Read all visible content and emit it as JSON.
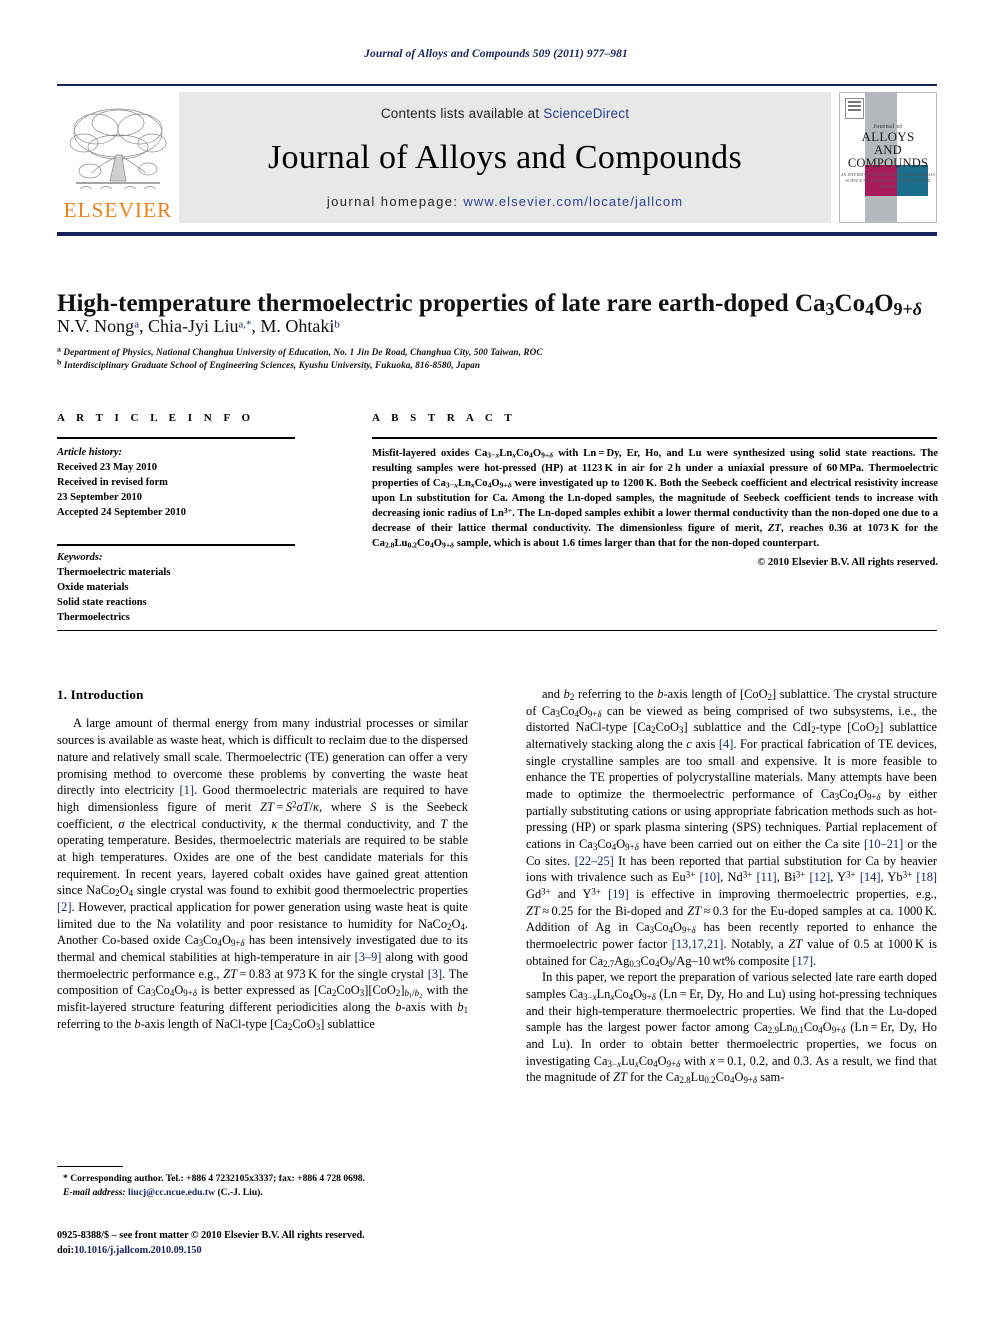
{
  "running_head": "Journal of Alloys and Compounds 509 (2011) 977–981",
  "masthead": {
    "contents_prefix": "Contents lists available at ",
    "sciencedirect": "ScienceDirect",
    "journal_title": "Journal of Alloys and Compounds",
    "homepage_prefix": "journal homepage: ",
    "homepage_url": "www.elsevier.com/locate/jallcom",
    "publisher": "ELSEVIER",
    "cover": {
      "line1": "Journal of",
      "line2": "ALLOYS",
      "line3": "AND COMPOUNDS",
      "line4": "AN INTERDISCIPLINARY JOURNAL OF MATERIALS SCIENCE AND SOLID-STATE CHEMISTRY AND PHYSICS"
    },
    "colors": {
      "rule": "#17215e",
      "panel": "#e8e8e9",
      "link": "#2b3e8c",
      "elsevier_orange": "#ef7f1a",
      "cover_magenta": "#a81b59",
      "cover_teal": "#1b6e8c",
      "cover_gray": "#b5b9bd"
    }
  },
  "article": {
    "title_html": "High-temperature thermoelectric properties of late rare earth-doped Ca<sub>3</sub>Co<sub>4</sub>O<sub>9+<i>&delta;</i></sub>",
    "authors_html": "N.V. Nong<sup>a</sup>, Chia-Jyi Liu<sup>a,*</sup>, M. Ohtaki<sup>b</sup>",
    "affiliation_a_html": "<sup>a</sup> Department of Physics, National Changhua University of Education, No. 1 Jin De Road, Changhua City, 500 Taiwan, ROC",
    "affiliation_b_html": "<sup>b</sup> Interdisciplinary Graduate School of Engineering Sciences, Kyushu University, Fukuoka, 816-8580, Japan"
  },
  "article_info": {
    "heading": "A R T I C L E   I N F O",
    "history_label": "Article history:",
    "history": [
      "Received 23 May 2010",
      "Received in revised form",
      "23 September 2010",
      "Accepted 24 September 2010"
    ],
    "keywords_label": "Keywords:",
    "keywords": [
      "Thermoelectric materials",
      "Oxide materials",
      "Solid state reactions",
      "Thermoelectrics"
    ]
  },
  "abstract": {
    "heading": "A B S T R A C T",
    "body_html": "Misfit-layered oxides Ca<sub>3&minus;<i>x</i></sub>Ln<sub><i>x</i></sub>Co<sub>4</sub>O<sub>9+<i>&delta;</i></sub> with Ln&#8239;=&#8239;Dy, Er, Ho, and Lu were synthesized using solid state reactions. The resulting samples were hot-pressed (HP) at 1123&#8201;K in air for 2&#8201;h under a uniaxial pressure of 60&#8201;MPa. Thermoelectric properties of Ca<sub>3&minus;<i>x</i></sub>Ln<sub><i>x</i></sub>Co<sub>4</sub>O<sub>9+<i>&delta;</i></sub> were investigated up to 1200&#8201;K. Both the Seebeck coefficient and electrical resistivity increase upon Ln substitution for Ca. Among the Ln-doped samples, the magnitude of Seebeck coefficient tends to increase with decreasing ionic radius of Ln<sup>3+</sup>. The Ln-doped samples exhibit a lower thermal conductivity than the non-doped one due to a decrease of their lattice thermal conductivity. The dimensionless figure of merit, <i>ZT</i>, reaches 0.36 at 1073&#8201;K for the Ca<sub>2.8</sub>Lu<sub>0.2</sub>Co<sub>4</sub>O<sub>9+<i>&delta;</i></sub> sample, which is about 1.6 times larger than that for the non-doped counterpart.",
    "copyright": "© 2010 Elsevier B.V. All rights reserved."
  },
  "body": {
    "section1_heading": "1.  Introduction",
    "left_paragraph_html": "A large amount of thermal energy from many industrial processes or similar sources is available as waste heat, which is difficult to reclaim due to the dispersed nature and relatively small scale. Thermoelectric (TE) generation can offer a very promising method to overcome these problems by converting the waste heat directly into electricity <span class=\"ref\">[1]</span>. Good thermoelectric materials are required to have high dimensionless figure of merit <i>ZT</i>&#8239;=&#8239;<i>S</i><sup>2</sup><i>&sigma;T</i>/<i>&kappa;</i>, where <i>S</i> is the Seebeck coefficient, <i>&sigma;</i> the electrical conductivity, <i>&kappa;</i> the thermal conductivity, and <i>T</i> the operating temperature. Besides, thermoelectric materials are required to be stable at high temperatures. Oxides are one of the best candidate materials for this requirement. In recent years, layered cobalt oxides have gained great attention since NaCo<sub>2</sub>O<sub>4</sub> single crystal was found to exhibit good thermoelectric properties <span class=\"ref\">[2]</span>. However, practical application for power generation using waste heat is quite limited due to the Na volatility and poor resistance to humidity for NaCo<sub>2</sub>O<sub>4</sub>. Another Co-based oxide Ca<sub>3</sub>Co<sub>4</sub>O<sub>9+<i>&delta;</i></sub> has been intensively investigated due to its thermal and chemical stabilities at high-temperature in air <span class=\"ref\">[3–9]</span> along with good thermoelectric performance e.g., <i>ZT</i>&#8239;=&#8239;0.83 at 973&#8201;K for the single crystal <span class=\"ref\">[3]</span>. The composition of Ca<sub>3</sub>Co<sub>4</sub>O<sub>9+<i>&delta;</i></sub> is better expressed as [Ca<sub>2</sub>CoO<sub>3</sub>][CoO<sub>2</sub>]<sub><i>b</i><sub>1</sub>/<i>b</i><sub>2</sub></sub> with the misfit-layered structure featuring different periodicities along the <i>b</i>-axis with <i>b</i><sub>1</sub> referring to the <i>b</i>-axis length of NaCl-type [Ca<sub>2</sub>CoO<sub>3</sub>] sublattice",
    "right_paragraph1_html": "and <i>b</i><sub>2</sub> referring to the <i>b</i>-axis length of [CoO<sub>2</sub>] sublattice. The crystal structure of Ca<sub>3</sub>Co<sub>4</sub>O<sub>9+<i>&delta;</i></sub> can be viewed as being comprised of two subsystems, i.e., the distorted NaCl-type [Ca<sub>2</sub>CoO<sub>3</sub>] sublattice and the CdI<sub>2</sub>-type [CoO<sub>2</sub>] sublattice alternatively stacking along the <i>c</i> axis <span class=\"ref\">[4]</span>. For practical fabrication of TE devices, single crystalline samples are too small and expensive. It is more feasible to enhance the TE properties of polycrystalline materials. Many attempts have been made to optimize the thermoelectric performance of Ca<sub>3</sub>Co<sub>4</sub>O<sub>9+<i>&delta;</i></sub> by either partially substituting cations or using appropriate fabrication methods such as hot-pressing (HP) or spark plasma sintering (SPS) techniques. Partial replacement of cations in Ca<sub>3</sub>Co<sub>4</sub>O<sub>9+<i>&delta;</i></sub> have been carried out on either the Ca site <span class=\"ref\">[10–21]</span> or the Co sites. <span class=\"ref\">[22–25]</span> It has been reported that partial substitution for Ca by heavier ions with trivalence such as Eu<sup>3+</sup> <span class=\"ref\">[10]</span>, Nd<sup>3+</sup> <span class=\"ref\">[11]</span>, Bi<sup>3+</sup> <span class=\"ref\">[12]</span>, Y<sup>3+</sup> <span class=\"ref\">[14]</span>, Yb<sup>3+</sup> <span class=\"ref\">[18]</span> Gd<sup>3+</sup> and Y<sup>3+</sup> <span class=\"ref\">[19]</span> is effective in improving thermoelectric properties, e.g., <i>ZT</i>&#8239;&asymp;&#8239;0.25 for the Bi-doped and <i>ZT</i>&#8239;&asymp;&#8239;0.3 for the Eu-doped samples at ca. 1000&#8201;K. Addition of Ag in Ca<sub>3</sub>Co<sub>4</sub>O<sub>9+<i>&delta;</i></sub> has been recently reported to enhance the thermoelectric power factor <span class=\"ref\">[13,17,21]</span>. Notably, a <i>ZT</i> value of 0.5 at 1000&#8201;K is obtained for Ca<sub>2.7</sub>Ag<sub>0.3</sub>Co<sub>4</sub>O<sub>9</sub>/Ag–10&#8201;wt% composite <span class=\"ref\">[17]</span>.",
    "right_paragraph2_html": "In this paper, we report the preparation of various selected late rare earth doped samples Ca<sub>3&minus;<i>x</i></sub>Ln<sub><i>x</i></sub>Co<sub>4</sub>O<sub>9+<i>&delta;</i></sub> (Ln&#8239;=&#8239;Er, Dy, Ho and Lu) using hot-pressing techniques and their high-temperature thermoelectric properties. We find that the Lu-doped sample has the largest power factor among Ca<sub>2.9</sub>Ln<sub>0.1</sub>Co<sub>4</sub>O<sub>9+<i>&delta;</i></sub> (Ln&#8239;=&#8239;Er, Dy, Ho and Lu). In order to obtain better thermoelectric properties, we focus on investigating Ca<sub>3&minus;<i>x</i></sub>Lu<sub><i>x</i></sub>Co<sub>4</sub>O<sub>9+<i>&delta;</i></sub> with <i>x</i>&#8239;=&#8239;0.1, 0.2, and 0.3. As a result, we find that the magnitude of <i>ZT</i> for the Ca<sub>2.8</sub>Lu<sub>0.2</sub>Co<sub>4</sub>O<sub>9+<i>&delta;</i></sub> sam-"
  },
  "footnotes": {
    "corresponding_html": "* Corresponding author. Tel.: +886 4 7232105x3337; fax: +886 4 728 0698.",
    "email_label": "E-mail address:",
    "email": "liucj@cc.ncue.edu.tw",
    "email_suffix": "(C.-J. Liu)."
  },
  "imprint": {
    "line1": "0925-8388/$ – see front matter © 2010 Elsevier B.V. All rights reserved.",
    "doi_label": "doi:",
    "doi_value": "10.1016/j.jallcom.2010.09.150"
  }
}
